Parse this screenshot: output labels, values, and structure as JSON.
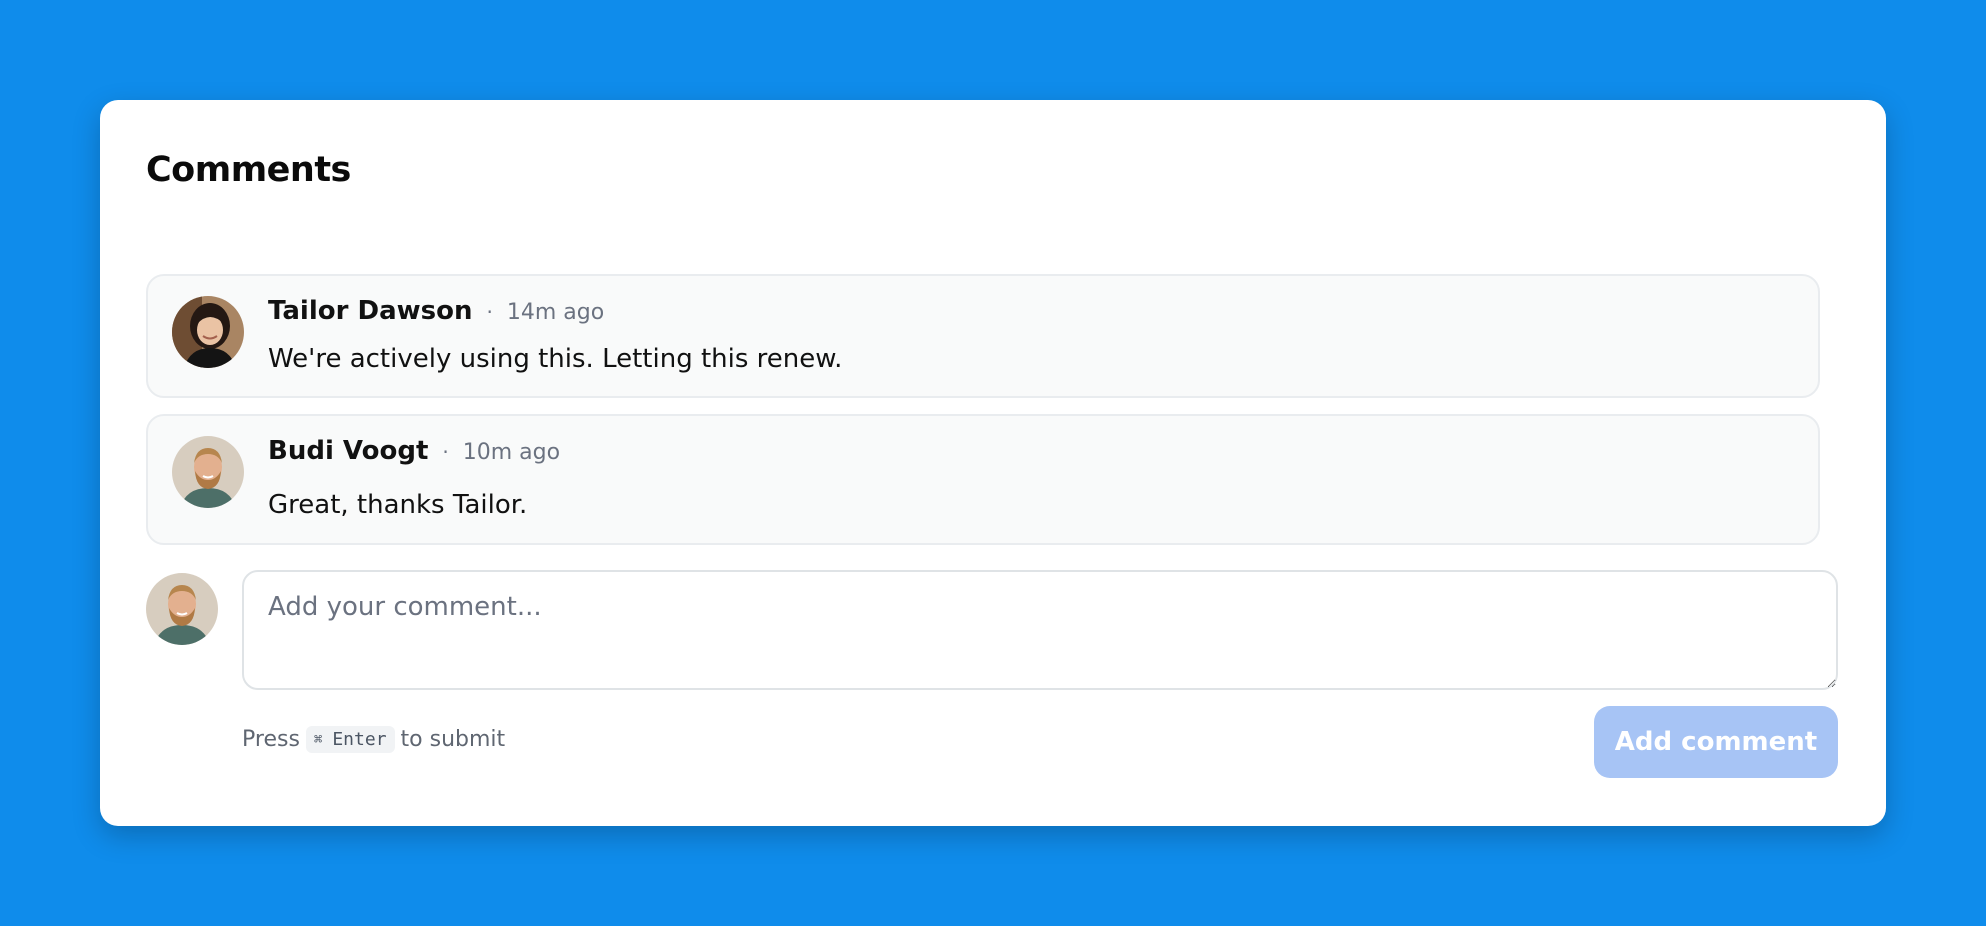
{
  "page": {
    "title": "Comments"
  },
  "comments": [
    {
      "author": "Tailor Dawson",
      "time": "14m ago",
      "text": "We're actively using this. Letting this renew.",
      "avatar": "avatar-woman-photo"
    },
    {
      "author": "Budi Voogt",
      "time": "10m ago",
      "text": "Great, thanks Tailor.",
      "avatar": "avatar-man-photo"
    }
  ],
  "composer": {
    "placeholder": "Add your comment...",
    "value": "",
    "avatar": "avatar-man-photo",
    "hint_prefix": "Press",
    "hint_key_symbol": "⌘",
    "hint_key": "Enter",
    "hint_suffix": "to submit",
    "submit_label": "Add comment"
  },
  "colors": {
    "background": "#0f8ceb",
    "card": "#ffffff",
    "comment_bg": "#f9fafa",
    "button_disabled": "#a7c4f5",
    "muted_text": "#6b7280"
  }
}
